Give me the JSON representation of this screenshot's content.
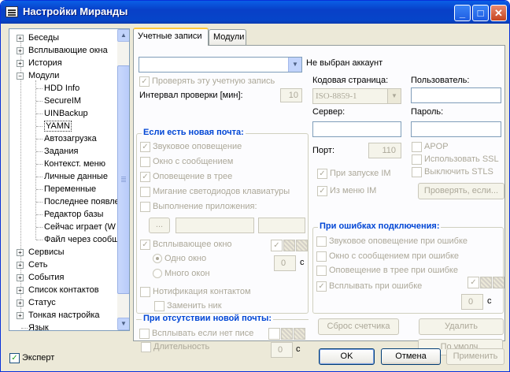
{
  "window": {
    "title": "Настройки Миранды"
  },
  "tree": {
    "items": [
      {
        "label": "Беседы",
        "expander": "+"
      },
      {
        "label": "Всплывающие окна",
        "expander": "+"
      },
      {
        "label": "История",
        "expander": "+"
      },
      {
        "label": "Модули",
        "expander": "−"
      },
      {
        "label": "HDD Info"
      },
      {
        "label": "SecureIM"
      },
      {
        "label": "UINBackup"
      },
      {
        "label": "YAMN"
      },
      {
        "label": "Автозагрузка"
      },
      {
        "label": "Задания"
      },
      {
        "label": "Контекст. меню"
      },
      {
        "label": "Личные данные"
      },
      {
        "label": "Переменные"
      },
      {
        "label": "Последнее появле"
      },
      {
        "label": "Редактор базы"
      },
      {
        "label": "Сейчас играет (W"
      },
      {
        "label": "Файл через сообщ"
      },
      {
        "label": "Сервисы",
        "expander": "+"
      },
      {
        "label": "Сеть",
        "expander": "+"
      },
      {
        "label": "События",
        "expander": "+"
      },
      {
        "label": "Список контактов",
        "expander": "+"
      },
      {
        "label": "Статус",
        "expander": "+"
      },
      {
        "label": "Тонкая настройка",
        "expander": "+"
      },
      {
        "label": "Язык"
      }
    ]
  },
  "tabs": [
    "Учетные записи",
    "Модули"
  ],
  "account": {
    "combo_value": "",
    "status": "Не выбран аккаунт",
    "check_account": "Проверять эту учетную запись",
    "interval_label": "Интервал проверки [мин]:",
    "interval_value": "10",
    "codepage_label": "Кодовая страница:",
    "codepage_value": "ISO-8859-1",
    "user_label": "Пользователь:",
    "server_label": "Сервер:",
    "password_label": "Пароль:",
    "port_label": "Порт:",
    "port_value": "110",
    "apop": "APOP",
    "ssl": "Использовать SSL",
    "stls": "Выключить STLS",
    "on_startup": "При запуске IM",
    "from_menu": "Из меню IM",
    "check_button": "Проверять, если...",
    "reset_button": "Сброс счетчика",
    "delete_button": "Удалить",
    "default_button": "По умолч."
  },
  "new_mail": {
    "title": "Если есть новая почта:",
    "sound": "Звуковое оповещение",
    "message_window": "Окно с сообщением",
    "tray": "Оповещение в трее",
    "kbd_leds": "Мигание светодиодов клавиатуры",
    "run_app": "Выполнение приложения:",
    "browse": "...",
    "popup": "Всплывающее окно",
    "one_window": "Одно окно",
    "many_windows": "Много окон",
    "popup_seconds": "0",
    "seconds_unit": "с",
    "contact_notify": "Нотификация контактом",
    "replace_nick": "Заменить ник"
  },
  "no_new_mail": {
    "title": "При отсутствии новой почты:",
    "popup_if_none": "Всплывать если нет писе",
    "duration": "Длительность",
    "duration_value": "0",
    "seconds_unit": "с"
  },
  "conn_errors": {
    "title": "При ошибках подключения:",
    "sound": "Звуковое оповещение при ошибке",
    "message_window": "Окно с сообщением при ошибке",
    "tray": "Оповещение в трее при ошибке",
    "popup": "Всплывать при ошибке",
    "popup_seconds": "0",
    "seconds_unit": "с"
  },
  "footer": {
    "expert": "Эксперт",
    "ok": "OK",
    "cancel": "Отмена",
    "apply": "Применить"
  }
}
